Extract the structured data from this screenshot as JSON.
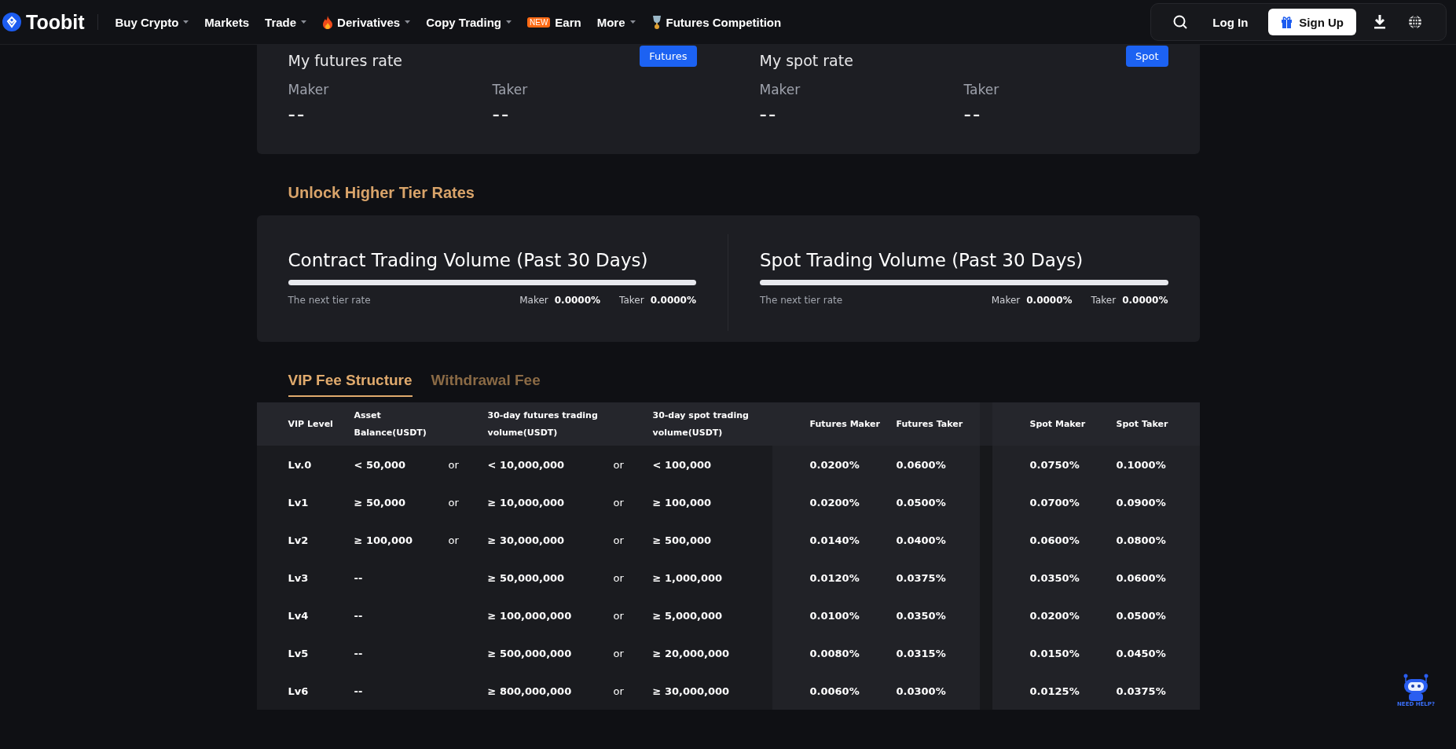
{
  "navbar": {
    "logo": "Toobit",
    "items": [
      {
        "label": "Buy Crypto",
        "dropdown": true,
        "kind": "plain"
      },
      {
        "label": "Markets",
        "dropdown": false,
        "kind": "plain"
      },
      {
        "label": "Trade",
        "dropdown": true,
        "kind": "plain"
      },
      {
        "label": "Derivatives",
        "dropdown": true,
        "kind": "flame"
      },
      {
        "label": "Copy Trading",
        "dropdown": true,
        "kind": "plain"
      },
      {
        "label": "Earn",
        "dropdown": false,
        "kind": "plain",
        "badge": "NEW"
      },
      {
        "label": "More",
        "dropdown": true,
        "kind": "plain"
      },
      {
        "label": "Futures Competition",
        "dropdown": false,
        "kind": "trophy"
      }
    ],
    "login": "Log In",
    "signup": "Sign Up"
  },
  "my_rates": [
    {
      "title": "My futures rate",
      "button": "Futures",
      "maker_label": "Maker",
      "maker_value": "--",
      "taker_label": "Taker",
      "taker_value": "--"
    },
    {
      "title": "My spot rate",
      "button": "Spot",
      "maker_label": "Maker",
      "maker_value": "--",
      "taker_label": "Taker",
      "taker_value": "--"
    }
  ],
  "unlock_title": "Unlock Higher Tier Rates",
  "volumes": [
    {
      "title": "Contract Trading Volume (Past 30 Days)",
      "level": 0,
      "next_tier": "The next tier rate",
      "maker_label": "Maker",
      "maker_value": "0.0000%",
      "taker_label": "Taker",
      "taker_value": "0.0000%"
    },
    {
      "title": "Spot Trading Volume (Past 30 Days)",
      "level": 0,
      "next_tier": "The next tier rate",
      "maker_label": "Maker",
      "maker_value": "0.0000%",
      "taker_label": "Taker",
      "taker_value": "0.0000%"
    }
  ],
  "tabs": [
    {
      "label": "VIP Fee Structure",
      "selected": true
    },
    {
      "label": "Withdrawal Fee",
      "selected": false
    }
  ],
  "table": {
    "columns": [
      "VIP Level",
      "Asset Balance(USDT)",
      "30-day futures trading volume(USDT)",
      "30-day spot trading volume(USDT)",
      "Futures Maker",
      "Futures Taker",
      "Spot Maker",
      "Spot Taker"
    ],
    "rows": [
      {
        "level": "Lv.0",
        "asset": "< 50,000",
        "asset_or": "or",
        "futures_volume": "< 10,000,000",
        "futures_or": "or",
        "spot_volume": "< 100,000",
        "futures_maker": "0.0200%",
        "futures_taker": "0.0600%",
        "spot_maker": "0.0750%",
        "spot_taker": "0.1000%"
      },
      {
        "level": "Lv1",
        "asset": "≥ 50,000",
        "asset_or": "or",
        "futures_volume": "≥ 10,000,000",
        "futures_or": "or",
        "spot_volume": "≥ 100,000",
        "futures_maker": "0.0200%",
        "futures_taker": "0.0500%",
        "spot_maker": "0.0700%",
        "spot_taker": "0.0900%"
      },
      {
        "level": "Lv2",
        "asset": "≥ 100,000",
        "asset_or": "or",
        "futures_volume": "≥ 30,000,000",
        "futures_or": "or",
        "spot_volume": "≥ 500,000",
        "futures_maker": "0.0140%",
        "futures_taker": "0.0400%",
        "spot_maker": "0.0600%",
        "spot_taker": "0.0800%"
      },
      {
        "level": "Lv3",
        "asset": "--",
        "futures_volume": "≥ 50,000,000",
        "futures_or": "or",
        "spot_volume": "≥ 1,000,000",
        "futures_maker": "0.0120%",
        "futures_taker": "0.0375%",
        "spot_maker": "0.0350%",
        "spot_taker": "0.0600%"
      },
      {
        "level": "Lv4",
        "asset": "--",
        "futures_volume": "≥ 100,000,000",
        "futures_or": "or",
        "spot_volume": "≥ 5,000,000",
        "futures_maker": "0.0100%",
        "futures_taker": "0.0350%",
        "spot_maker": "0.0200%",
        "spot_taker": "0.0500%"
      },
      {
        "level": "Lv5",
        "asset": "--",
        "futures_volume": "≥ 500,000,000",
        "futures_or": "or",
        "spot_volume": "≥ 20,000,000",
        "futures_maker": "0.0080%",
        "futures_taker": "0.0315%",
        "spot_maker": "0.0150%",
        "spot_taker": "0.0450%"
      },
      {
        "level": "Lv6",
        "asset": "--",
        "futures_volume": "≥ 800,000,000",
        "futures_or": "or",
        "spot_volume": "≥ 30,000,000",
        "futures_maker": "0.0060%",
        "futures_taker": "0.0300%",
        "spot_maker": "0.0125%",
        "spot_taker": "0.0375%"
      }
    ]
  },
  "help": {
    "label": "NEED HELP?"
  }
}
